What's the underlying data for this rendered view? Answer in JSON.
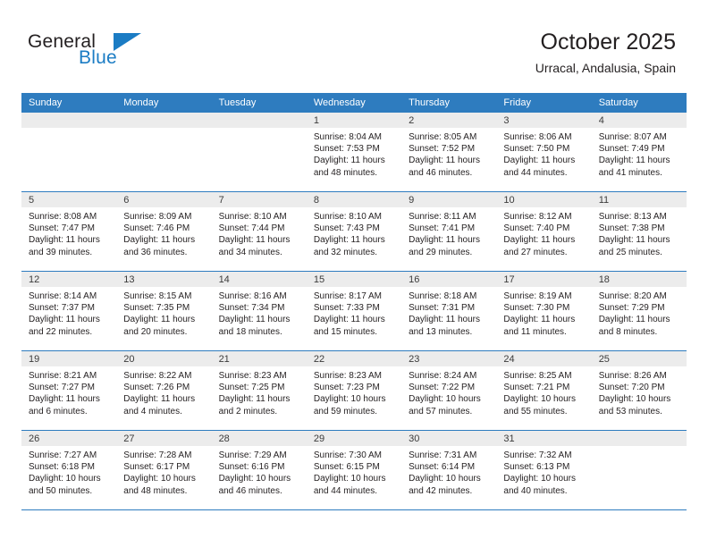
{
  "logo": {
    "word1": "General",
    "word2": "Blue",
    "triangle_color": "#1b7cc4"
  },
  "header": {
    "title": "October 2025",
    "location": "Urracal, Andalusia, Spain",
    "header_bg": "#2e7cbf",
    "daynum_bg": "#ececec"
  },
  "weekdays": [
    "Sunday",
    "Monday",
    "Tuesday",
    "Wednesday",
    "Thursday",
    "Friday",
    "Saturday"
  ],
  "labels": {
    "sunrise_prefix": "Sunrise: ",
    "sunset_prefix": "Sunset: ",
    "daylight_prefix": "Daylight: "
  },
  "weeks": [
    [
      {
        "day": "",
        "blank": true
      },
      {
        "day": "",
        "blank": true
      },
      {
        "day": "",
        "blank": true
      },
      {
        "day": "1",
        "sunrise": "Sunrise: 8:04 AM",
        "sunset": "Sunset: 7:53 PM",
        "daylight_1": "Daylight: 11 hours",
        "daylight_2": "and 48 minutes."
      },
      {
        "day": "2",
        "sunrise": "Sunrise: 8:05 AM",
        "sunset": "Sunset: 7:52 PM",
        "daylight_1": "Daylight: 11 hours",
        "daylight_2": "and 46 minutes."
      },
      {
        "day": "3",
        "sunrise": "Sunrise: 8:06 AM",
        "sunset": "Sunset: 7:50 PM",
        "daylight_1": "Daylight: 11 hours",
        "daylight_2": "and 44 minutes."
      },
      {
        "day": "4",
        "sunrise": "Sunrise: 8:07 AM",
        "sunset": "Sunset: 7:49 PM",
        "daylight_1": "Daylight: 11 hours",
        "daylight_2": "and 41 minutes."
      }
    ],
    [
      {
        "day": "5",
        "sunrise": "Sunrise: 8:08 AM",
        "sunset": "Sunset: 7:47 PM",
        "daylight_1": "Daylight: 11 hours",
        "daylight_2": "and 39 minutes."
      },
      {
        "day": "6",
        "sunrise": "Sunrise: 8:09 AM",
        "sunset": "Sunset: 7:46 PM",
        "daylight_1": "Daylight: 11 hours",
        "daylight_2": "and 36 minutes."
      },
      {
        "day": "7",
        "sunrise": "Sunrise: 8:10 AM",
        "sunset": "Sunset: 7:44 PM",
        "daylight_1": "Daylight: 11 hours",
        "daylight_2": "and 34 minutes."
      },
      {
        "day": "8",
        "sunrise": "Sunrise: 8:10 AM",
        "sunset": "Sunset: 7:43 PM",
        "daylight_1": "Daylight: 11 hours",
        "daylight_2": "and 32 minutes."
      },
      {
        "day": "9",
        "sunrise": "Sunrise: 8:11 AM",
        "sunset": "Sunset: 7:41 PM",
        "daylight_1": "Daylight: 11 hours",
        "daylight_2": "and 29 minutes."
      },
      {
        "day": "10",
        "sunrise": "Sunrise: 8:12 AM",
        "sunset": "Sunset: 7:40 PM",
        "daylight_1": "Daylight: 11 hours",
        "daylight_2": "and 27 minutes."
      },
      {
        "day": "11",
        "sunrise": "Sunrise: 8:13 AM",
        "sunset": "Sunset: 7:38 PM",
        "daylight_1": "Daylight: 11 hours",
        "daylight_2": "and 25 minutes."
      }
    ],
    [
      {
        "day": "12",
        "sunrise": "Sunrise: 8:14 AM",
        "sunset": "Sunset: 7:37 PM",
        "daylight_1": "Daylight: 11 hours",
        "daylight_2": "and 22 minutes."
      },
      {
        "day": "13",
        "sunrise": "Sunrise: 8:15 AM",
        "sunset": "Sunset: 7:35 PM",
        "daylight_1": "Daylight: 11 hours",
        "daylight_2": "and 20 minutes."
      },
      {
        "day": "14",
        "sunrise": "Sunrise: 8:16 AM",
        "sunset": "Sunset: 7:34 PM",
        "daylight_1": "Daylight: 11 hours",
        "daylight_2": "and 18 minutes."
      },
      {
        "day": "15",
        "sunrise": "Sunrise: 8:17 AM",
        "sunset": "Sunset: 7:33 PM",
        "daylight_1": "Daylight: 11 hours",
        "daylight_2": "and 15 minutes."
      },
      {
        "day": "16",
        "sunrise": "Sunrise: 8:18 AM",
        "sunset": "Sunset: 7:31 PM",
        "daylight_1": "Daylight: 11 hours",
        "daylight_2": "and 13 minutes."
      },
      {
        "day": "17",
        "sunrise": "Sunrise: 8:19 AM",
        "sunset": "Sunset: 7:30 PM",
        "daylight_1": "Daylight: 11 hours",
        "daylight_2": "and 11 minutes."
      },
      {
        "day": "18",
        "sunrise": "Sunrise: 8:20 AM",
        "sunset": "Sunset: 7:29 PM",
        "daylight_1": "Daylight: 11 hours",
        "daylight_2": "and 8 minutes."
      }
    ],
    [
      {
        "day": "19",
        "sunrise": "Sunrise: 8:21 AM",
        "sunset": "Sunset: 7:27 PM",
        "daylight_1": "Daylight: 11 hours",
        "daylight_2": "and 6 minutes."
      },
      {
        "day": "20",
        "sunrise": "Sunrise: 8:22 AM",
        "sunset": "Sunset: 7:26 PM",
        "daylight_1": "Daylight: 11 hours",
        "daylight_2": "and 4 minutes."
      },
      {
        "day": "21",
        "sunrise": "Sunrise: 8:23 AM",
        "sunset": "Sunset: 7:25 PM",
        "daylight_1": "Daylight: 11 hours",
        "daylight_2": "and 2 minutes."
      },
      {
        "day": "22",
        "sunrise": "Sunrise: 8:23 AM",
        "sunset": "Sunset: 7:23 PM",
        "daylight_1": "Daylight: 10 hours",
        "daylight_2": "and 59 minutes."
      },
      {
        "day": "23",
        "sunrise": "Sunrise: 8:24 AM",
        "sunset": "Sunset: 7:22 PM",
        "daylight_1": "Daylight: 10 hours",
        "daylight_2": "and 57 minutes."
      },
      {
        "day": "24",
        "sunrise": "Sunrise: 8:25 AM",
        "sunset": "Sunset: 7:21 PM",
        "daylight_1": "Daylight: 10 hours",
        "daylight_2": "and 55 minutes."
      },
      {
        "day": "25",
        "sunrise": "Sunrise: 8:26 AM",
        "sunset": "Sunset: 7:20 PM",
        "daylight_1": "Daylight: 10 hours",
        "daylight_2": "and 53 minutes."
      }
    ],
    [
      {
        "day": "26",
        "sunrise": "Sunrise: 7:27 AM",
        "sunset": "Sunset: 6:18 PM",
        "daylight_1": "Daylight: 10 hours",
        "daylight_2": "and 50 minutes."
      },
      {
        "day": "27",
        "sunrise": "Sunrise: 7:28 AM",
        "sunset": "Sunset: 6:17 PM",
        "daylight_1": "Daylight: 10 hours",
        "daylight_2": "and 48 minutes."
      },
      {
        "day": "28",
        "sunrise": "Sunrise: 7:29 AM",
        "sunset": "Sunset: 6:16 PM",
        "daylight_1": "Daylight: 10 hours",
        "daylight_2": "and 46 minutes."
      },
      {
        "day": "29",
        "sunrise": "Sunrise: 7:30 AM",
        "sunset": "Sunset: 6:15 PM",
        "daylight_1": "Daylight: 10 hours",
        "daylight_2": "and 44 minutes."
      },
      {
        "day": "30",
        "sunrise": "Sunrise: 7:31 AM",
        "sunset": "Sunset: 6:14 PM",
        "daylight_1": "Daylight: 10 hours",
        "daylight_2": "and 42 minutes."
      },
      {
        "day": "31",
        "sunrise": "Sunrise: 7:32 AM",
        "sunset": "Sunset: 6:13 PM",
        "daylight_1": "Daylight: 10 hours",
        "daylight_2": "and 40 minutes."
      },
      {
        "day": "",
        "blank": true
      }
    ]
  ]
}
